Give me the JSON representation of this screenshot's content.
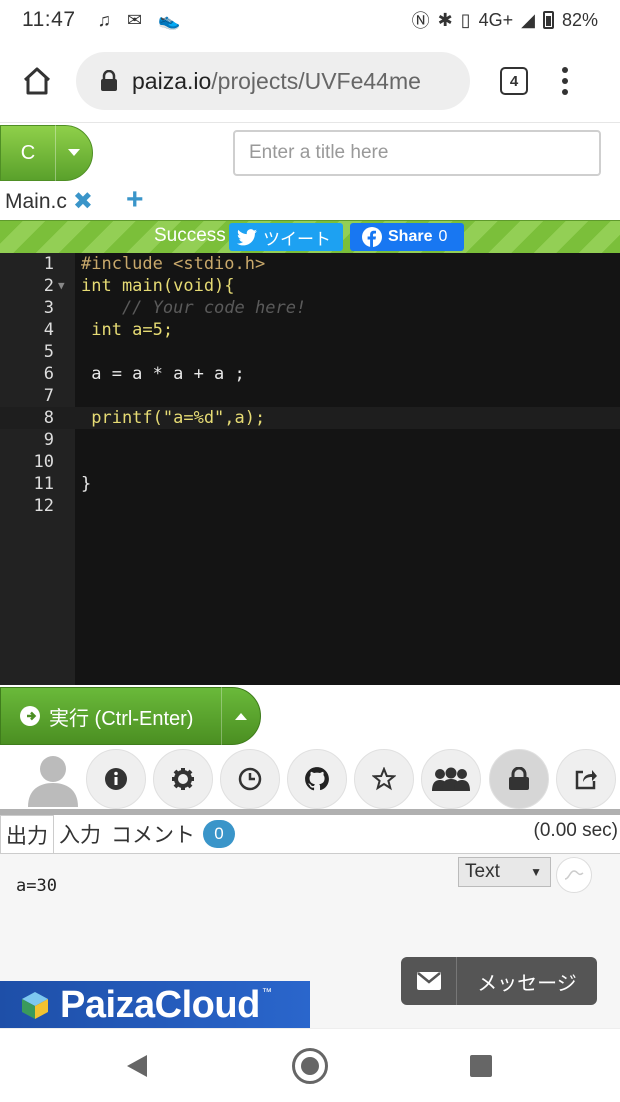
{
  "status": {
    "time": "11:47",
    "network": "4G+",
    "battery": "82%"
  },
  "browser": {
    "url_host": "paiza.io",
    "url_path": "/projects/UVFe44me",
    "tab_count": "4"
  },
  "editor_header": {
    "language": "C",
    "title_placeholder": "Enter a title here",
    "file_name": "Main.c",
    "close_symbol": "✖",
    "add_symbol": "+",
    "status": "Success",
    "tweet_label": "ツイート",
    "share_label": "Share",
    "share_count": "0"
  },
  "code_lines": [
    {
      "num": "1",
      "text": "#include <stdio.h>"
    },
    {
      "num": "2",
      "text": "int main(void){"
    },
    {
      "num": "3",
      "text": "    // Your code here!"
    },
    {
      "num": "4",
      "text": " int a=5;"
    },
    {
      "num": "5",
      "text": ""
    },
    {
      "num": "6",
      "text": " a = a * a + a ;"
    },
    {
      "num": "7",
      "text": ""
    },
    {
      "num": "8",
      "text": " printf(\"a=%d\",a);"
    },
    {
      "num": "9",
      "text": ""
    },
    {
      "num": "10",
      "text": ""
    },
    {
      "num": "11",
      "text": "}"
    },
    {
      "num": "12",
      "text": ""
    }
  ],
  "run": {
    "label": "実行 (Ctrl-Enter)"
  },
  "toolbar": {
    "icons": [
      "info-icon",
      "gear-icon",
      "clock-icon",
      "github-icon",
      "star-icon",
      "group-icon",
      "lock-icon",
      "share-icon"
    ],
    "active": "lock-icon"
  },
  "output": {
    "tab_output": "出力",
    "tab_input": "入力",
    "tab_comment": "コメント",
    "comment_count": "0",
    "exec_time": "(0.00 sec)",
    "result": "a=30",
    "format": "Text",
    "message_label": "メッセージ",
    "brand": "PaizaCloud",
    "brand_tm": "™"
  },
  "colors": {
    "green": "#6ab93a",
    "editor_bg": "#141414",
    "accent_blue": "#3a95c9",
    "twitter": "#1da1f2",
    "facebook": "#1877f2"
  }
}
